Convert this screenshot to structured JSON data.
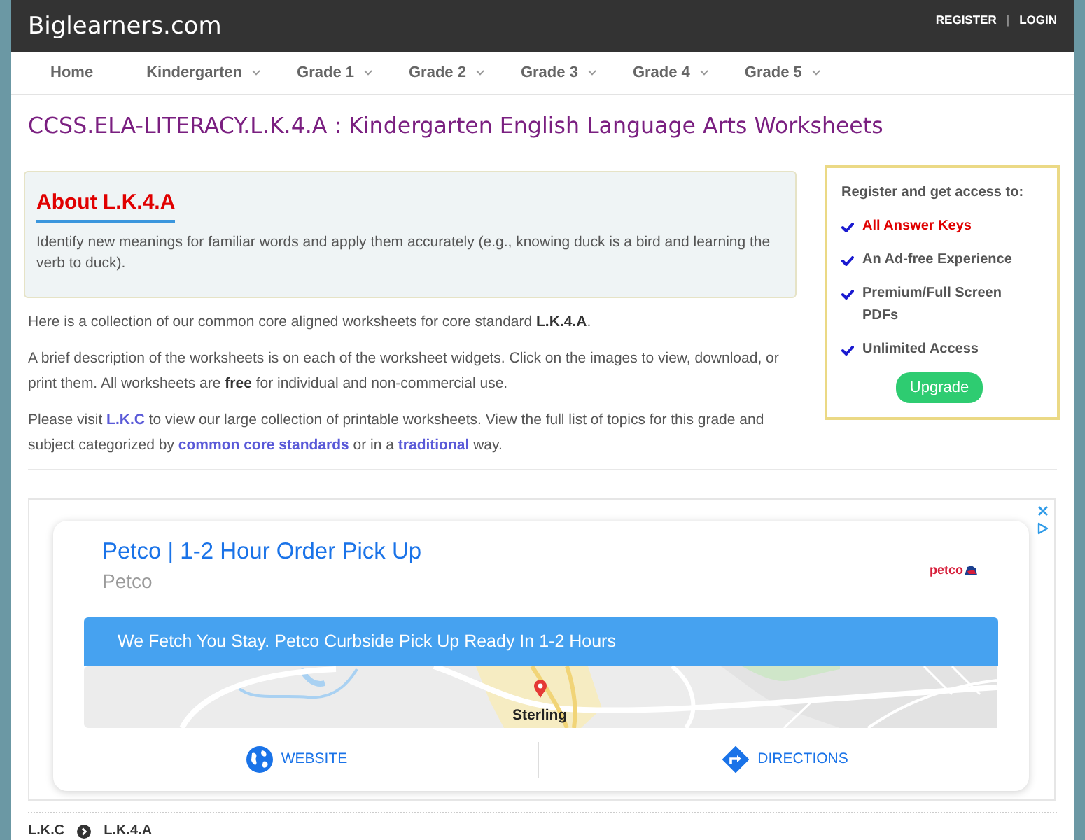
{
  "header": {
    "logo": "Biglearners.com",
    "links": [
      {
        "label": "REGISTER"
      },
      {
        "label": "LOGIN"
      }
    ],
    "separator": "|"
  },
  "nav": {
    "items": [
      {
        "label": "Home",
        "kind": "link"
      },
      {
        "label": "Kindergarten",
        "kind": "dropdown"
      },
      {
        "label": "Grade 1",
        "kind": "dropdown"
      },
      {
        "label": "Grade 2",
        "kind": "dropdown"
      },
      {
        "label": "Grade 3",
        "kind": "dropdown"
      },
      {
        "label": "Grade 4",
        "kind": "dropdown"
      },
      {
        "label": "Grade 5",
        "kind": "dropdown"
      }
    ]
  },
  "page_title": "CCSS.ELA-LITERACY.L.K.4.A : Kindergarten English Language Arts Worksheets",
  "about": {
    "heading": "About L.K.4.A",
    "text": "Identify new meanings for familiar words and apply them accurately (e.g., knowing duck is a bird and learning the verb to duck)."
  },
  "intro": [
    {
      "parts": [
        {
          "kind": "text",
          "text": "Here is a collection of our common core aligned worksheets for core standard **L.K.4.A**."
        }
      ]
    },
    {
      "parts": [
        {
          "kind": "text",
          "text": "A brief description of the worksheets is on each of the worksheet widgets. Click on the images to view, download, or print them. All worksheets are **free** for individual and non-commercial use."
        }
      ]
    },
    {
      "parts": [
        {
          "kind": "text",
          "text": "Please visit "
        },
        {
          "kind": "link",
          "text": "L.K.C"
        },
        {
          "kind": "text",
          "text": " to view our large collection of printable worksheets. View the full list of topics for this grade and subject categorized by "
        },
        {
          "kind": "link",
          "text": "common core standards"
        },
        {
          "kind": "text",
          "text": " or in a "
        },
        {
          "kind": "link",
          "text": "traditional"
        },
        {
          "kind": "text",
          "text": " way."
        }
      ]
    }
  ],
  "register": {
    "title": "Register and get access to:",
    "features": [
      {
        "label": "All Answer Keys",
        "highlighted": true
      },
      {
        "label": "An Ad-free Experience",
        "highlighted": false
      },
      {
        "label": "Premium/Full Screen PDFs",
        "highlighted": false
      },
      {
        "label": "Unlimited Access",
        "highlighted": false
      }
    ],
    "button": "Upgrade"
  },
  "ad": {
    "title": "Petco | 1-2 Hour Order Pick Up",
    "advertiser": "Petco",
    "logo": "petco",
    "banner": "We Fetch You Stay. Petco Curbside Pick Up Ready In 1-2 Hours",
    "map_label": "Sterling",
    "actions": [
      {
        "label": "WEBSITE",
        "kind": "website"
      },
      {
        "label": "DIRECTIONS",
        "kind": "directions"
      }
    ]
  },
  "breadcrumb": {
    "items": [
      {
        "label": "L.K.C"
      },
      {
        "label": "L.K.4.A"
      }
    ]
  }
}
